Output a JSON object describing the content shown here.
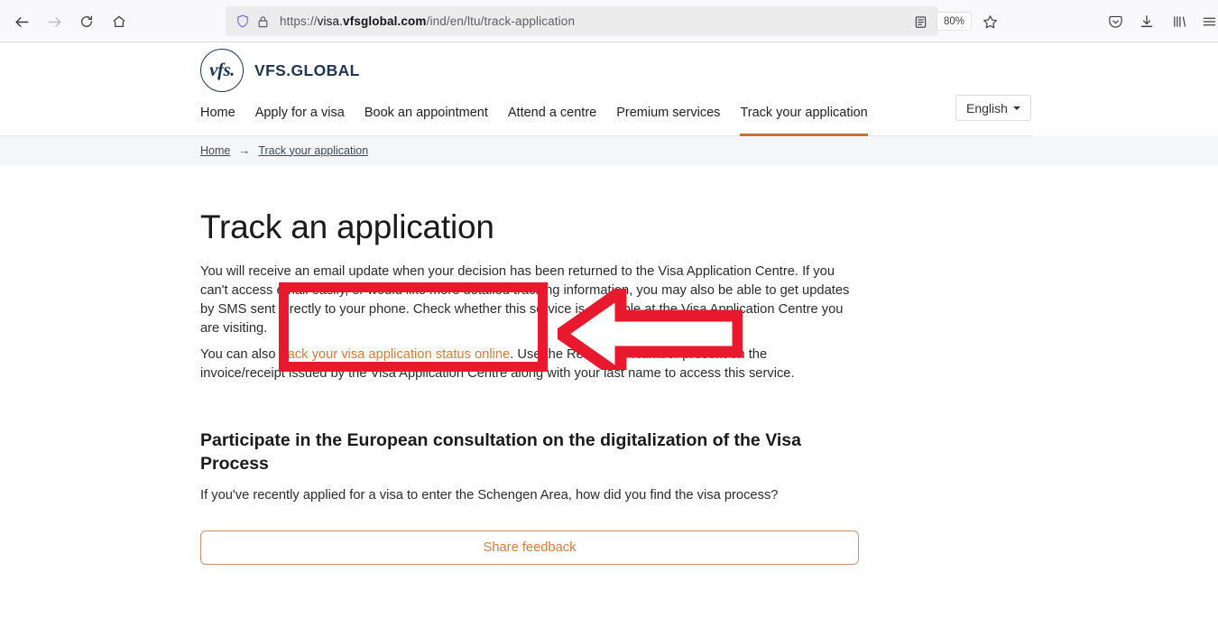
{
  "browser": {
    "url_prefix": "https://",
    "url_subdomain": "visa.",
    "url_host": "vfsglobal.com",
    "url_path": "/ind/en/ltu/track-application",
    "zoom_level": "80%",
    "icons": {
      "back": "back-arrow-icon",
      "forward": "forward-arrow-icon",
      "reload": "reload-icon",
      "home": "home-icon",
      "shield": "shield-icon",
      "lock": "lock-icon",
      "reader": "reader-view-icon",
      "star": "bookmark-star-icon",
      "pocket": "pocket-icon",
      "downloads": "downloads-icon",
      "library": "library-icon",
      "menu": "hamburger-menu-icon"
    }
  },
  "header": {
    "logo_mark": "vfs.",
    "brand": "VFS.GLOBAL",
    "language": "English"
  },
  "nav": {
    "items": [
      {
        "label": "Home",
        "active": false
      },
      {
        "label": "Apply for a visa",
        "active": false
      },
      {
        "label": "Book an appointment",
        "active": false
      },
      {
        "label": "Attend a centre",
        "active": false
      },
      {
        "label": "Premium services",
        "active": false
      },
      {
        "label": "Track your application",
        "active": true
      }
    ]
  },
  "breadcrumb": {
    "home": "Home",
    "separator": "→",
    "current": "Track your application"
  },
  "main": {
    "title": "Track an application",
    "intro_paragraph": "You will receive an email update when your decision has been returned to the Visa Application Centre. If you can't access email easily, or would like more detailed tracking information, you may also be able to get updates by SMS sent directly to your phone. Check whether this service is available at the Visa Application Centre you are visiting.",
    "track_paragraph_before": "You can also ",
    "track_link": "track your visa application status online",
    "track_paragraph_after": ". Use the Reference Number present on the invoice/receipt issued by the Visa Application Centre along with your last name to access this service.",
    "section_heading": "Participate in the European consultation on the digitalization of the Visa Process",
    "section_subtext": "If you've recently applied for a visa to enter the Schengen Area, how did you find the visa process?",
    "share_feedback_label": "Share feedback"
  },
  "annotations": {
    "highlight_color": "#e8192c",
    "arrow_color": "#e8192c",
    "highlight_target": "track-your-visa-application-status-online-link",
    "arrow_direction": "left"
  },
  "colors": {
    "brand_navy": "#1d3557",
    "accent_orange": "#e07b39",
    "nav_active_underline": "#c87137",
    "breadcrumb_bg": "#f5f6f8",
    "annotation_red": "#e8192c"
  }
}
